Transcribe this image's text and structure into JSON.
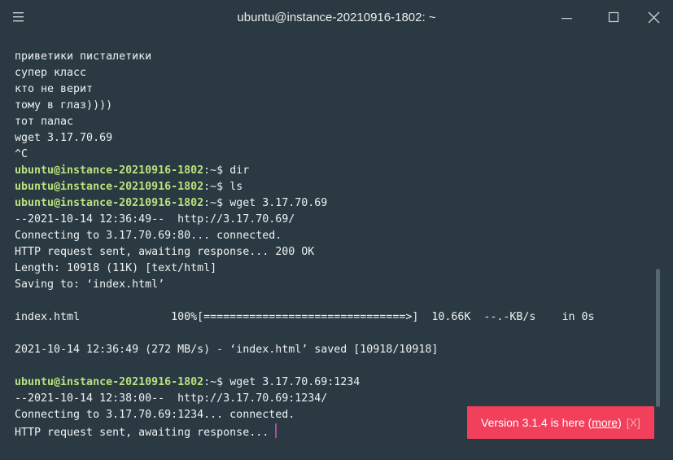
{
  "window": {
    "title": "ubuntu@instance-20210916-1802: ~"
  },
  "terminal": {
    "lines": [
      {
        "text": "приветики писталетики"
      },
      {
        "text": "супер класс"
      },
      {
        "text": "кто не верит"
      },
      {
        "text": "тому в глаз))))"
      },
      {
        "text": "тот палас"
      },
      {
        "text": "wget 3.17.70.69"
      },
      {
        "text": "^C"
      },
      {
        "user": "ubuntu@instance-20210916-1802",
        "path": ":~$",
        "cmd": " dir"
      },
      {
        "user": "ubuntu@instance-20210916-1802",
        "path": ":~$",
        "cmd": " ls"
      },
      {
        "user": "ubuntu@instance-20210916-1802",
        "path": ":~$",
        "cmd": " wget 3.17.70.69"
      },
      {
        "text": "--2021-10-14 12:36:49--  http://3.17.70.69/"
      },
      {
        "text": "Connecting to 3.17.70.69:80... connected."
      },
      {
        "text": "HTTP request sent, awaiting response... 200 OK"
      },
      {
        "text": "Length: 10918 (11K) [text/html]"
      },
      {
        "text": "Saving to: ‘index.html’"
      },
      {
        "text": ""
      },
      {
        "text": "index.html              100%[===============================>]  10.66K  --.-KB/s    in 0s"
      },
      {
        "text": ""
      },
      {
        "text": "2021-10-14 12:36:49 (272 MB/s) - ‘index.html’ saved [10918/10918]"
      },
      {
        "text": ""
      },
      {
        "user": "ubuntu@instance-20210916-1802",
        "path": ":~$",
        "cmd": " wget 3.17.70.69:1234"
      },
      {
        "text": "--2021-10-14 12:38:00--  http://3.17.70.69:1234/"
      },
      {
        "text": "Connecting to 3.17.70.69:1234... connected."
      },
      {
        "text": "HTTP request sent, awaiting response...",
        "cursor": true
      }
    ]
  },
  "toast": {
    "prefix": "Version 3.1.4 is here (",
    "link": "more",
    "suffix": ")",
    "close": "[X]"
  },
  "icons": {
    "menu": "hamburger-menu-icon",
    "minimize": "minimize-icon",
    "maximize": "maximize-icon",
    "close": "close-icon"
  },
  "colors": {
    "background": "#2b3a42",
    "prompt_user": "#b9e27f",
    "toast_background": "#f2405c",
    "cursor": "#b04aa6"
  }
}
